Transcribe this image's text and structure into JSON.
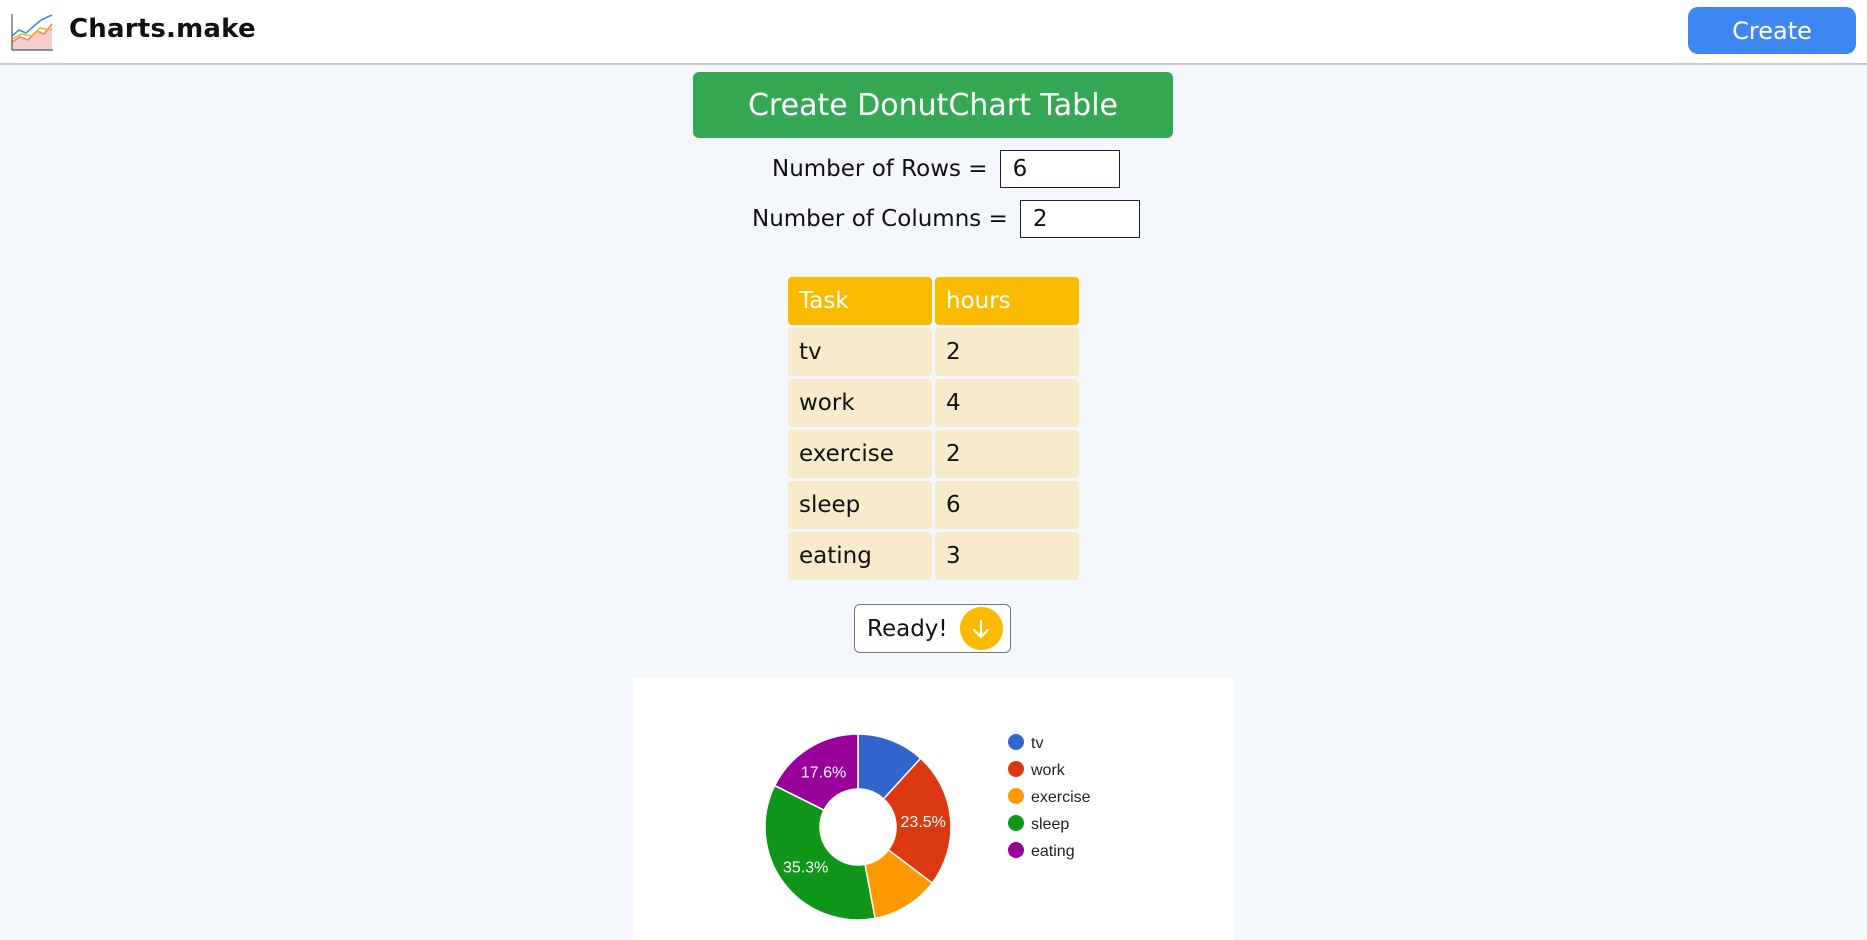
{
  "app": {
    "name": "Charts.make",
    "create_label": "Create"
  },
  "page": {
    "title": "Create DonutChart Table",
    "rows_label": "Number of Rows =",
    "rows_value": "6",
    "cols_label": "Number of Columns =",
    "cols_value": "2",
    "ready_label": "Ready!"
  },
  "table": {
    "headers": [
      "Task",
      "hours"
    ],
    "rows": [
      [
        "tv",
        "2"
      ],
      [
        "work",
        "4"
      ],
      [
        "exercise",
        "2"
      ],
      [
        "sleep",
        "6"
      ],
      [
        "eating",
        "3"
      ]
    ]
  },
  "colors": {
    "primary": "#3f87f0",
    "title_green": "#34a853",
    "table_header": "#f9ba00",
    "table_cell": "#f7ebcc"
  },
  "chart_data": {
    "type": "pie",
    "donut": true,
    "categories": [
      "tv",
      "work",
      "exercise",
      "sleep",
      "eating"
    ],
    "values": [
      2,
      4,
      2,
      6,
      3
    ],
    "colors": [
      "#3366cc",
      "#dc3912",
      "#ff9900",
      "#109618",
      "#990099"
    ],
    "data_labels": [
      "",
      "23.5%",
      "",
      "35.3%",
      "17.6%"
    ],
    "legend_position": "right"
  }
}
